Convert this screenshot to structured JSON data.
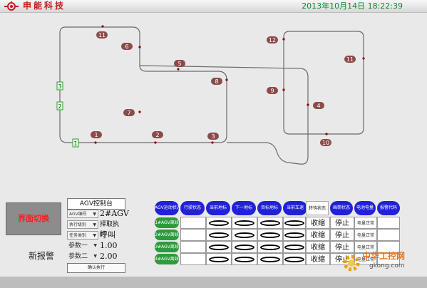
{
  "header": {
    "company": "申能科技",
    "datetime": "2013年10月14日 18:22:39"
  },
  "track": {
    "stations_red": [
      "1",
      "2",
      "3",
      "4",
      "5",
      "6",
      "7",
      "8",
      "9",
      "10",
      "11",
      "12"
    ],
    "stations_green": [
      "1",
      "2",
      "3"
    ]
  },
  "switch_button": "界面切换",
  "alarm_label": "新报警",
  "control": {
    "title": "AGV控制台",
    "rows": [
      {
        "key": "AGV编号",
        "value": "2#AGV"
      },
      {
        "key": "执行级别",
        "value": "择取执行"
      },
      {
        "key": "任务类别",
        "value": "呼叫"
      },
      {
        "key": "参数一",
        "value": "1.00"
      },
      {
        "key": "参数二",
        "value": "2.00"
      }
    ],
    "confirm": "确认执行"
  },
  "table": {
    "headers": [
      "AGV运动状态",
      "行驶状态",
      "当前地标",
      "下一地标",
      "目标地标",
      "当前车速",
      "转钩状态",
      "画筒状态",
      "电池电量",
      "报警代码"
    ],
    "rows": [
      {
        "name": "1#AGV离线",
        "hook": "收缩",
        "drum": "停止",
        "battery": "电量正常"
      },
      {
        "name": "2#AGV离线",
        "hook": "收缩",
        "drum": "停止",
        "battery": "电量正常"
      },
      {
        "name": "3#AGV离线",
        "hook": "收缩",
        "drum": "停止",
        "battery": "电量正常"
      },
      {
        "name": "4#AGV离线",
        "hook": "收缩",
        "drum": "停止",
        "battery": "电量正常"
      }
    ]
  },
  "watermark": {
    "cn": "中华工控网",
    "en": "gkong.com"
  },
  "colors": {
    "accent_blue": "#2121d8",
    "status_green": "#2b9b3d",
    "alarm_red": "#ff1a1a",
    "clock_green": "#0a8a2e"
  }
}
